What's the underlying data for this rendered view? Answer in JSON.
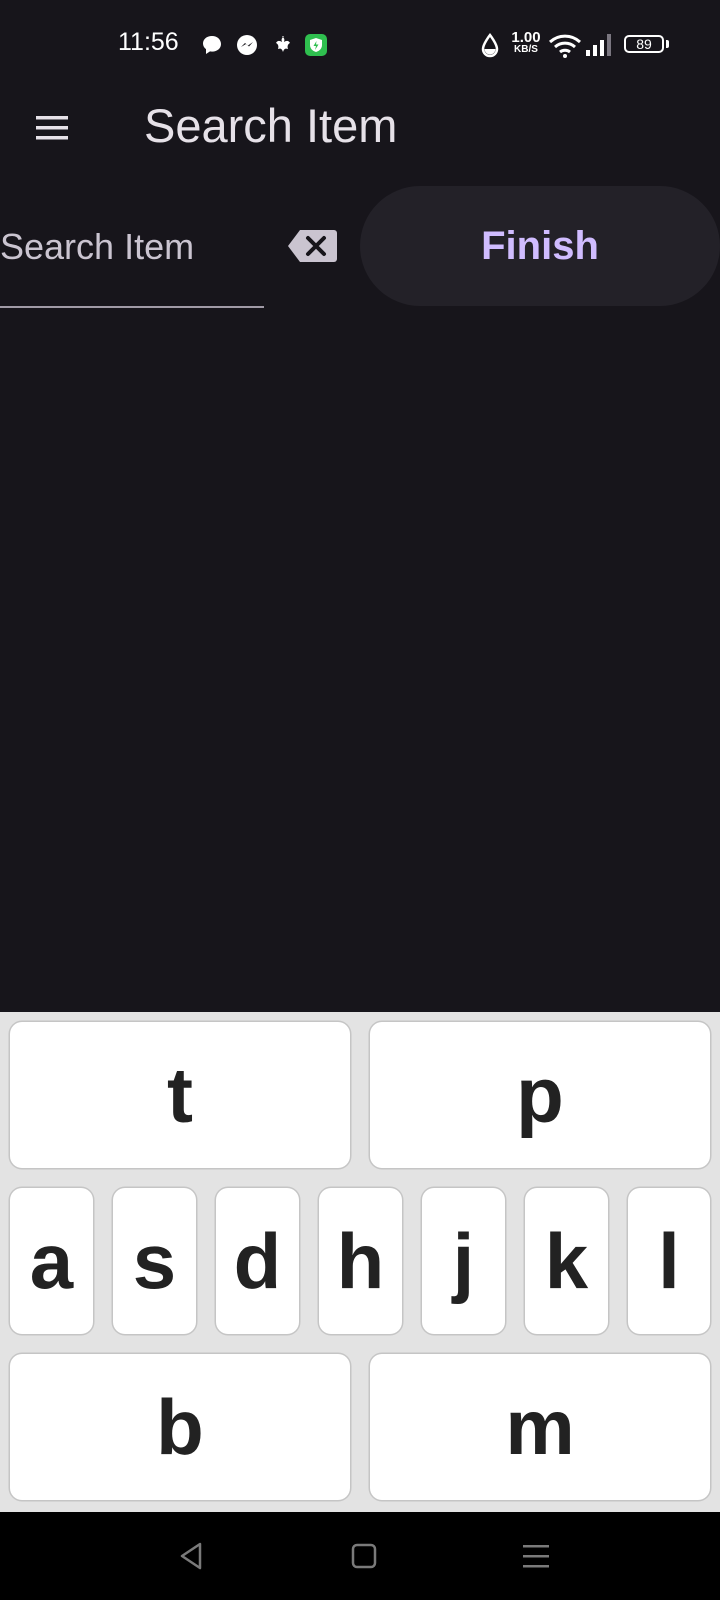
{
  "status_bar": {
    "time": "11:56",
    "net_speed_value": "1.00",
    "net_speed_unit": "KB/S",
    "battery": "89",
    "icons": [
      "chat-bubble-icon",
      "messenger-icon",
      "leaf-icon",
      "shield-app-icon",
      "water-drop-icon",
      "wifi-icon",
      "signal-icon",
      "battery-icon"
    ]
  },
  "app_bar": {
    "title": "Search Item",
    "menu_icon": "hamburger-menu-icon"
  },
  "search": {
    "placeholder": "Search Item",
    "clear_icon": "backspace-clear-icon",
    "finish_label": "Finish"
  },
  "keyboard": {
    "row1": [
      "t",
      "p"
    ],
    "row2": [
      "a",
      "s",
      "d",
      "h",
      "j",
      "k",
      "l"
    ],
    "row3": [
      "b",
      "m"
    ]
  },
  "nav_bar": {
    "buttons": [
      "back-icon",
      "home-icon",
      "recents-icon"
    ]
  },
  "colors": {
    "background": "#17151b",
    "accent": "#d0bcff",
    "finish_button_bg": "#232128",
    "keyboard_bg": "#e3e3e3",
    "key_bg": "#ffffff"
  }
}
